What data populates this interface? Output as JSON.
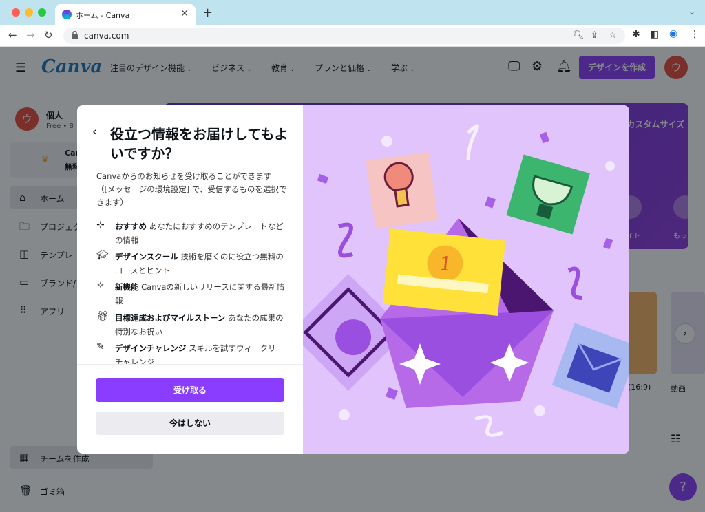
{
  "browser": {
    "tab_title": "ホーム - Canva",
    "url": "canva.com"
  },
  "header": {
    "logo": "Canva",
    "nav": [
      {
        "label": "注目のデザイン機能"
      },
      {
        "label": "ビジネス"
      },
      {
        "label": "教育"
      },
      {
        "label": "プランと価格"
      },
      {
        "label": "学ぶ"
      }
    ],
    "create_button": "デザインを作成",
    "avatar_initial": "ウ"
  },
  "sidebar": {
    "account_name": "個人",
    "account_plan": "Free • 8",
    "avatar_initial": "ウ",
    "promo_line1": "Can",
    "promo_line2": "無料ト",
    "items": [
      {
        "label": "ホーム"
      },
      {
        "label": "プロジェク"
      },
      {
        "label": "テンプレー"
      },
      {
        "label": "ブランド/"
      },
      {
        "label": "アプリ"
      }
    ],
    "create_team": "チームを作成",
    "trash": "ゴミ箱"
  },
  "main": {
    "hero_text": "カスタムサイズ",
    "hero_label1": "イト",
    "hero_label2": "もっ",
    "thumb_label1": "(16:9)",
    "thumb_label2": "動画"
  },
  "modal": {
    "title": "役立つ情報をお届けしてもよいですか？",
    "description": "Canvaからのお知らせを受け取ることができます（[メッセージの環境設定] で、受信するものを選択できます）",
    "features": [
      {
        "icon": "sparkle-card-icon",
        "bold": "おすすめ",
        "text": " あなたにおすすめのテンプレートなどの情報"
      },
      {
        "icon": "graduation-cap-icon",
        "bold": "デザインスクール",
        "text": " 技術を磨くのに役立つ無料のコースとヒント"
      },
      {
        "icon": "sparkles-icon",
        "bold": "新機能",
        "text": " Canvaの新しいリリースに関する最新情報"
      },
      {
        "icon": "gift-icon",
        "bold": "目標達成およびマイルストーン",
        "text": " あなたの成果の特別なお祝い"
      },
      {
        "icon": "pencil-icon",
        "bold": "デザインチャレンジ",
        "text": " スキルを試すウィークリーチャレンジ"
      }
    ],
    "accept_button": "受け取る",
    "later_button": "今はしない"
  },
  "colors": {
    "brand_purple": "#8b3dff",
    "illustration_bg": "#e0c4fb",
    "logo_blue": "#1b74bb",
    "avatar_red": "#e64a3c"
  }
}
